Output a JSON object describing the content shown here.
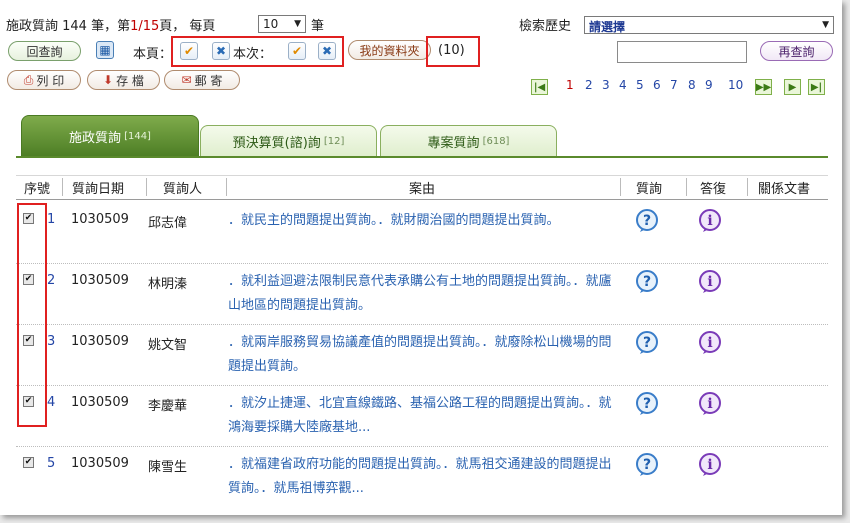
{
  "status": {
    "prefix": "施政質詢 144 筆，第",
    "page": "1/15",
    "suffix_page": "頁， 每頁",
    "per_page": "10",
    "suffix_rec": "筆"
  },
  "history": {
    "label": "檢索歷史",
    "value": "請選擇"
  },
  "toolbar": {
    "back": "回查詢",
    "this_page": "本頁：",
    "this_time": "本次：",
    "my_folder": "我的資料夾",
    "folder_count": "(10)",
    "requery": "再查詢",
    "print": "列 印",
    "save": "存 檔",
    "mail": "郵 寄"
  },
  "pager": {
    "pages": [
      "1",
      "2",
      "3",
      "4",
      "5",
      "6",
      "7",
      "8",
      "9",
      "10"
    ],
    "current": "1"
  },
  "tabs": [
    {
      "label": "施政質詢",
      "count": "[144]"
    },
    {
      "label": "預決算質(諮)詢",
      "count": "[12]"
    },
    {
      "label": "專案質詢",
      "count": "[618]"
    }
  ],
  "headers": [
    "序號",
    "質詢日期",
    "質詢人",
    "案由",
    "質詢",
    "答復",
    "關係文書"
  ],
  "rows": [
    {
      "no": "1",
      "date": "1030509",
      "name": "邱志偉",
      "reason": "．就民主的問題提出質詢。．就財閥治國的問題提出質詢。"
    },
    {
      "no": "2",
      "date": "1030509",
      "name": "林明溱",
      "reason": "．就利益迴避法限制民意代表承購公有土地的問題提出質詢。．就廬山地區的問題提出質詢。"
    },
    {
      "no": "3",
      "date": "1030509",
      "name": "姚文智",
      "reason": "．就兩岸服務貿易協議產值的問題提出質詢。．就廢除松山機場的問題提出質詢。"
    },
    {
      "no": "4",
      "date": "1030509",
      "name": "李慶華",
      "reason": "．就汐止捷運、北宜直線鐵路、基福公路工程的問題提出質詢。．就鴻海要採購大陸廠基地..."
    },
    {
      "no": "5",
      "date": "1030509",
      "name": "陳雪生",
      "reason": "．就福建省政府功能的問題提出質詢。．就馬祖交通建設的問題提出質詢。．就馬祖博弈觀..."
    }
  ],
  "colors": {
    "accent": "#5a8a2c",
    "link": "#2a62b0",
    "highlight": "#e02020"
  }
}
